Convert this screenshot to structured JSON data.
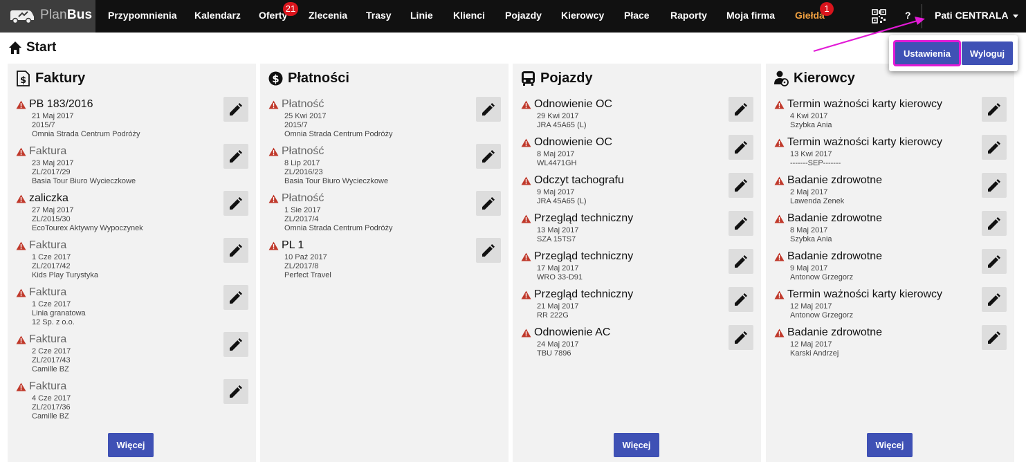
{
  "app": {
    "logo_light": "Plan",
    "logo_bold": "Bus"
  },
  "nav": {
    "items": [
      {
        "label": "Przypomnienia"
      },
      {
        "label": "Kalendarz"
      },
      {
        "label": "Oferty",
        "badge": "21"
      },
      {
        "label": "Zlecenia"
      },
      {
        "label": "Trasy"
      },
      {
        "label": "Linie"
      },
      {
        "label": "Klienci"
      },
      {
        "label": "Pojazdy"
      },
      {
        "label": "Kierowcy"
      },
      {
        "label": "Płace"
      },
      {
        "label": "Raporty"
      },
      {
        "label": "Moja firma"
      },
      {
        "label": "Giełda",
        "badge": "1",
        "color": "#f0a040"
      }
    ],
    "help": "?",
    "user": "Pati CENTRALA"
  },
  "dropdown": {
    "settings": "Ustawienia",
    "logout": "Wyloguj"
  },
  "page": {
    "title": "Start"
  },
  "panels": {
    "faktury": {
      "title": "Faktury",
      "more": "Więcej",
      "items": [
        {
          "title": "PB 183/2016",
          "muted": false,
          "lines": [
            "21 Maj 2017",
            "2015/7",
            "Omnia Strada Centrum Podróży"
          ]
        },
        {
          "title": "Faktura",
          "muted": true,
          "lines": [
            "23 Maj 2017",
            "ZL/2017/29",
            "Basia Tour Biuro Wycieczkowe"
          ]
        },
        {
          "title": "zaliczka",
          "muted": false,
          "lines": [
            "27 Maj 2017",
            "ZL/2015/30",
            "EcoTourex Aktywny Wypoczynek"
          ]
        },
        {
          "title": "Faktura",
          "muted": true,
          "lines": [
            "1 Cze 2017",
            "ZL/2017/42",
            "Kids Play Turystyka"
          ]
        },
        {
          "title": "Faktura",
          "muted": true,
          "lines": [
            "1 Cze 2017",
            "Linia granatowa",
            "12 Sp. z o.o."
          ]
        },
        {
          "title": "Faktura",
          "muted": true,
          "lines": [
            "2 Cze 2017",
            "ZL/2017/43",
            "Camille BZ"
          ]
        },
        {
          "title": "Faktura",
          "muted": true,
          "lines": [
            "4 Cze 2017",
            "ZL/2017/36",
            "Camille BZ"
          ]
        }
      ]
    },
    "platnosci": {
      "title": "Płatności",
      "items": [
        {
          "title": "Płatność",
          "muted": true,
          "lines": [
            "25 Kwi 2017",
            "2015/7",
            "Omnia Strada Centrum Podróży"
          ]
        },
        {
          "title": "Płatność",
          "muted": true,
          "lines": [
            "8 Lip 2017",
            "ZL/2016/23",
            "Basia Tour Biuro Wycieczkowe"
          ]
        },
        {
          "title": "Płatność",
          "muted": true,
          "lines": [
            "1 Sie 2017",
            "ZL/2017/4",
            "Omnia Strada Centrum Podróży"
          ]
        },
        {
          "title": "PL 1",
          "muted": false,
          "lines": [
            "10 Paź 2017",
            "ZL/2017/8",
            "Perfect Travel"
          ]
        }
      ]
    },
    "pojazdy": {
      "title": "Pojazdy",
      "more": "Więcej",
      "items": [
        {
          "title": "Odnowienie OC",
          "lines": [
            "29 Kwi 2017",
            "JRA 45A65 (L)"
          ]
        },
        {
          "title": "Odnowienie OC",
          "lines": [
            "8 Maj 2017",
            "WL4471GH"
          ]
        },
        {
          "title": "Odczyt tachografu",
          "lines": [
            "9 Maj 2017",
            "JRA 45A65 (L)"
          ]
        },
        {
          "title": "Przegląd techniczny",
          "lines": [
            "13 Maj 2017",
            "SZA 15TS7"
          ]
        },
        {
          "title": "Przegląd techniczny",
          "lines": [
            "17 Maj 2017",
            "WRO 33-D91"
          ]
        },
        {
          "title": "Przegląd techniczny",
          "lines": [
            "21 Maj 2017",
            "RR 222G"
          ]
        },
        {
          "title": "Odnowienie AC",
          "lines": [
            "24 Maj 2017",
            "TBU 7896"
          ]
        }
      ]
    },
    "kierowcy": {
      "title": "Kierowcy",
      "more": "Więcej",
      "items": [
        {
          "title": "Termin ważności karty kierowcy",
          "lines": [
            "4 Kwi 2017",
            "Szybka Ania"
          ]
        },
        {
          "title": "Termin ważności karty kierowcy",
          "lines": [
            "13 Kwi 2017",
            "-------SEP-------"
          ]
        },
        {
          "title": "Badanie zdrowotne",
          "lines": [
            "2 Maj 2017",
            "Lawenda Zenek"
          ]
        },
        {
          "title": "Badanie zdrowotne",
          "lines": [
            "8 Maj 2017",
            "Szybka Ania"
          ]
        },
        {
          "title": "Badanie zdrowotne",
          "lines": [
            "9 Maj 2017",
            "Antonow Grzegorz"
          ]
        },
        {
          "title": "Termin ważności karty kierowcy",
          "lines": [
            "12 Maj 2017",
            "Antonow Grzegorz"
          ]
        },
        {
          "title": "Badanie zdrowotne",
          "lines": [
            "12 Maj 2017",
            "Karski Andrzej"
          ]
        }
      ]
    }
  },
  "colors": {
    "accent": "#3f51b5",
    "warning": "#c0392b",
    "highlight": "#e21ad6",
    "badge": "#d9141c"
  }
}
